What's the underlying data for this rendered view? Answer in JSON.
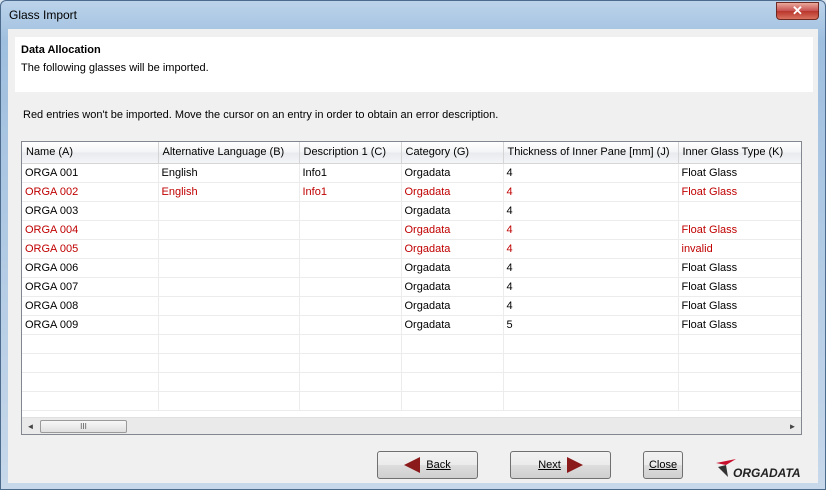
{
  "window": {
    "title": "Glass Import",
    "close_glyph": "✕"
  },
  "header": {
    "title": "Data Allocation",
    "subtitle": "The following glasses will be imported."
  },
  "info_text": "Red entries won't be imported. Move the cursor on an entry in order to obtain an error description.",
  "table": {
    "columns": [
      "Name (A)",
      "Alternative Language (B)",
      "Description 1 (C)",
      "Category (G)",
      "Thickness of Inner Pane [mm] (J)",
      "Inner Glass Type (K)"
    ],
    "rows": [
      {
        "error": false,
        "cells": [
          "ORGA 001",
          "English",
          "Info1",
          "Orgadata",
          "4",
          "Float Glass"
        ]
      },
      {
        "error": true,
        "cells": [
          "ORGA 002",
          "English",
          "Info1",
          "Orgadata",
          "4",
          "Float Glass"
        ]
      },
      {
        "error": false,
        "cells": [
          "ORGA 003",
          "",
          "",
          "Orgadata",
          "4",
          ""
        ]
      },
      {
        "error": true,
        "cells": [
          "ORGA 004",
          "",
          "",
          "Orgadata",
          "4",
          "Float Glass"
        ]
      },
      {
        "error": true,
        "cells": [
          "ORGA 005",
          "",
          "",
          "Orgadata",
          "4",
          "invalid"
        ]
      },
      {
        "error": false,
        "cells": [
          "ORGA 006",
          "",
          "",
          "Orgadata",
          "4",
          "Float Glass"
        ]
      },
      {
        "error": false,
        "cells": [
          "ORGA 007",
          "",
          "",
          "Orgadata",
          "4",
          "Float Glass"
        ]
      },
      {
        "error": false,
        "cells": [
          "ORGA 008",
          "",
          "",
          "Orgadata",
          "4",
          "Float Glass"
        ]
      },
      {
        "error": false,
        "cells": [
          "ORGA 009",
          "",
          "",
          "Orgadata",
          "5",
          "Float Glass"
        ]
      }
    ],
    "empty_rows": 4,
    "error_color": "#c00000"
  },
  "scrollbar": {
    "left_glyph": "◄",
    "right_glyph": "►",
    "thumb_grip": "III"
  },
  "buttons": {
    "back": "Back",
    "next": "Next",
    "close": "Close"
  },
  "logo": {
    "text": "ORGADATA",
    "accent": "#c8102e"
  }
}
